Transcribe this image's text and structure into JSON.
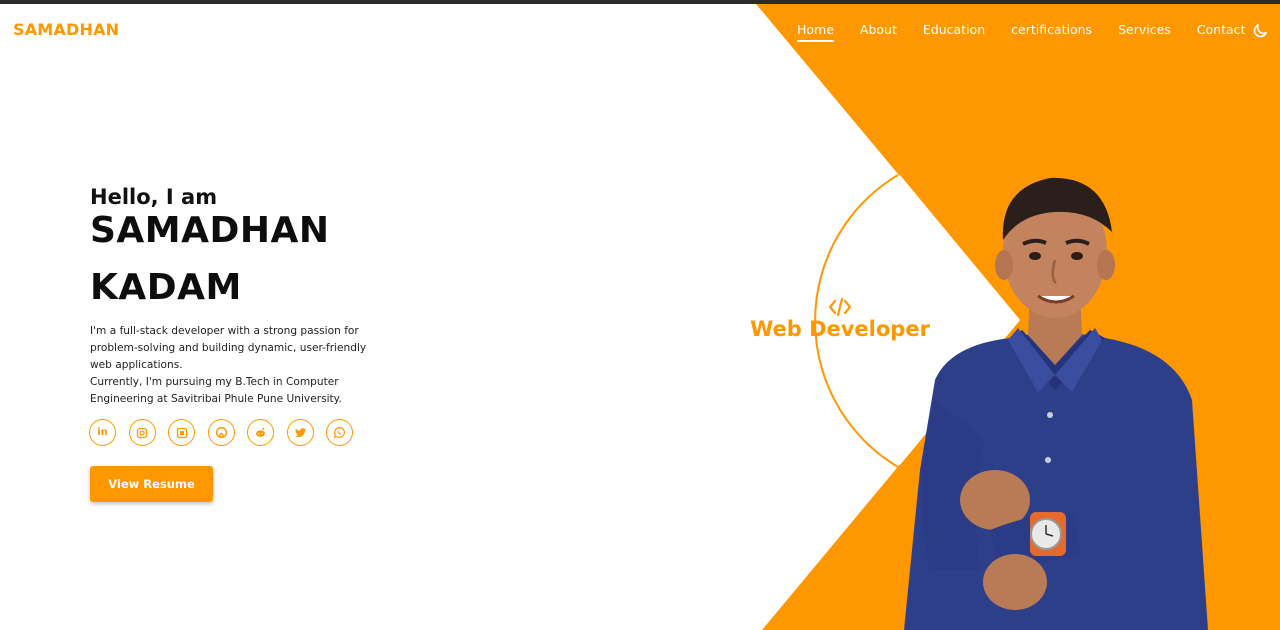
{
  "brand": {
    "logo_text": "SAMADHAN",
    "accent_color": "#ff9800"
  },
  "nav": {
    "links": [
      {
        "label": "Home",
        "active": true
      },
      {
        "label": "About",
        "active": false
      },
      {
        "label": "Education",
        "active": false
      },
      {
        "label": "certifications",
        "active": false
      },
      {
        "label": "Services",
        "active": false
      },
      {
        "label": "Contact",
        "active": false
      }
    ],
    "theme_toggle_icon": "moon-icon"
  },
  "hero": {
    "greeting": "Hello, I am",
    "name_first": "SAMADHAN",
    "name_last": "KADAM",
    "bio_line_1": "I'm a full-stack developer with a strong passion for problem-solving and building dynamic, user-friendly web applications.",
    "bio_line_2": "Currently, I'm pursuing my B.Tech in Computer Engineering at Savitribai Phule Pune University.",
    "resume_button": "View Resume"
  },
  "social": [
    {
      "name": "linkedin-icon",
      "glyph": "in"
    },
    {
      "name": "instagram-icon",
      "glyph": ""
    },
    {
      "name": "blog-icon",
      "glyph": ""
    },
    {
      "name": "github-icon",
      "glyph": ""
    },
    {
      "name": "reddit-icon",
      "glyph": ""
    },
    {
      "name": "twitter-icon",
      "glyph": ""
    },
    {
      "name": "whatsapp-icon",
      "glyph": ""
    }
  ],
  "role": {
    "icon": "code-icon",
    "label": "Web Developer"
  }
}
